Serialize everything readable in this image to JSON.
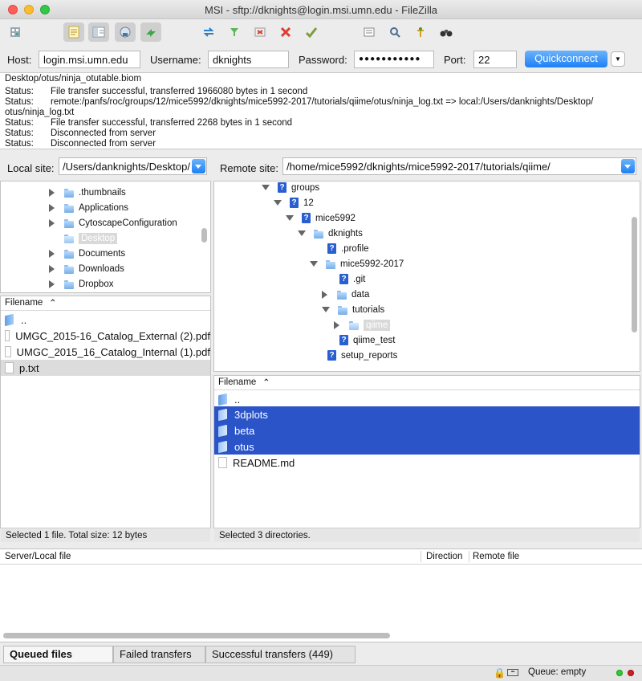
{
  "window": {
    "title": "MSI - sftp://dknights@login.msi.umn.edu - FileZilla",
    "colors": {
      "close": "#fc5f57",
      "minimize": "#fdbc2e",
      "maximize": "#33c748",
      "accent": "#1d80f6",
      "selection": "#2a54c7"
    }
  },
  "toolbar": {
    "icons": [
      "site-manager-icon",
      "toggle-log-icon",
      "toggle-tree-icon",
      "toggle-remote-tree-icon",
      "toggle-queue-icon",
      "refresh-icon",
      "filter-icon",
      "process-queue-icon",
      "cancel-icon",
      "disconnect-icon",
      "reconnect-icon",
      "compare-icon",
      "sync-browse-icon",
      "search-icon",
      "binoculars-icon"
    ]
  },
  "quickconnect": {
    "host_label": "Host:",
    "host_value": "login.msi.umn.edu",
    "username_label": "Username:",
    "username_value": "dknights",
    "password_label": "Password:",
    "password_value": "●●●●●●●●●●●",
    "port_label": "Port:",
    "port_value": "22",
    "button_label": "Quickconnect"
  },
  "log": {
    "lines": [
      {
        "status": "",
        "text": "Desktop/otus/ninja_otutable.biom"
      },
      {
        "status": "Status:",
        "text": "File transfer successful, transferred 1966080 bytes in 1 second"
      },
      {
        "status": "Status:",
        "text": "remote:/panfs/roc/groups/12/mice5992/dknights/mice5992-2017/tutorials/qiime/otus/ninja_log.txt => local:/Users/danknights/Desktop/"
      },
      {
        "status": "",
        "text": "otus/ninja_log.txt"
      },
      {
        "status": "Status:",
        "text": "File transfer successful, transferred 2268 bytes in 1 second"
      },
      {
        "status": "Status:",
        "text": "Disconnected from server"
      },
      {
        "status": "Status:",
        "text": "Disconnected from server"
      }
    ]
  },
  "local": {
    "site_label": "Local site:",
    "site_path": "/Users/danknights/Desktop/",
    "tree": [
      {
        "label": ".thumbnails",
        "expander": "r"
      },
      {
        "label": "Applications",
        "expander": "r"
      },
      {
        "label": "CytoscapeConfiguration",
        "expander": "r"
      },
      {
        "label": "Desktop",
        "expander": "n",
        "selected": true
      },
      {
        "label": "Documents",
        "expander": "r"
      },
      {
        "label": "Downloads",
        "expander": "r"
      },
      {
        "label": "Dropbox",
        "expander": "r"
      }
    ],
    "list_header": "Filename",
    "files": [
      {
        "name": "..",
        "type": "folder"
      },
      {
        "name": "UMGC_2015-16_Catalog_External (2).pdf",
        "type": "file"
      },
      {
        "name": "UMGC_2015_16_Catalog_Internal (1).pdf",
        "type": "file"
      },
      {
        "name": "p.txt",
        "type": "file",
        "selected": true
      }
    ],
    "status": "Selected 1 file. Total size: 12 bytes"
  },
  "remote": {
    "site_label": "Remote site:",
    "site_path": "/home/mice5992/dknights/mice5992-2017/tutorials/qiime/",
    "tree": [
      {
        "label": "groups",
        "expander": "d",
        "icon": "q",
        "depth": 0
      },
      {
        "label": "12",
        "expander": "d",
        "icon": "q",
        "depth": 1
      },
      {
        "label": "mice5992",
        "expander": "d",
        "icon": "q",
        "depth": 2
      },
      {
        "label": "dknights",
        "expander": "d",
        "icon": "folder",
        "depth": 3
      },
      {
        "label": ".profile",
        "expander": "n",
        "icon": "q",
        "depth": 4
      },
      {
        "label": "mice5992-2017",
        "expander": "d",
        "icon": "folder",
        "depth": 4
      },
      {
        "label": ".git",
        "expander": "n",
        "icon": "q",
        "depth": 5
      },
      {
        "label": "data",
        "expander": "r",
        "icon": "folder",
        "depth": 5
      },
      {
        "label": "tutorials",
        "expander": "d",
        "icon": "folder",
        "depth": 5
      },
      {
        "label": "qiime",
        "expander": "r",
        "icon": "folder-open",
        "depth": 6,
        "selected": true
      },
      {
        "label": "qiime_test",
        "expander": "n",
        "icon": "q",
        "depth": 5
      },
      {
        "label": "setup_reports",
        "expander": "n",
        "icon": "q",
        "depth": 4
      }
    ],
    "list_header": "Filename",
    "files": [
      {
        "name": "..",
        "type": "folder"
      },
      {
        "name": "3dplots",
        "type": "folder",
        "selected": true
      },
      {
        "name": "beta",
        "type": "folder",
        "selected": true
      },
      {
        "name": "otus",
        "type": "folder",
        "selected": true
      },
      {
        "name": "README.md",
        "type": "file"
      }
    ],
    "status": "Selected 3 directories."
  },
  "queue": {
    "col_server": "Server/Local file",
    "col_direction": "Direction",
    "col_remote": "Remote file",
    "tabs": [
      "Queued files",
      "Failed transfers",
      "Successful transfers (449)"
    ],
    "status": "Queue: empty"
  }
}
